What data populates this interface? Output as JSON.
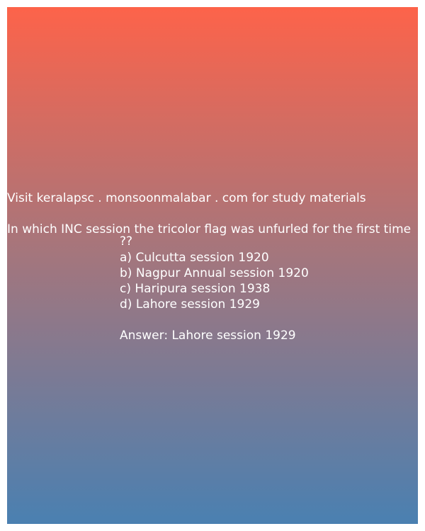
{
  "site_line": "Visit keralapsc . monsoonmalabar . com for study materials",
  "question": {
    "text": "In which INC session the tricolor flag was unfurled for the first time",
    "continuation": "??"
  },
  "options": [
    "a) Culcutta session 1920",
    "b) Nagpur Annual session 1920",
    "c) Haripura session 1938",
    "d) Lahore session 1929"
  ],
  "answer": "Answer: Lahore session 1929",
  "colors": {
    "gradient_top": "#fd634a",
    "gradient_mid": "#a9757a",
    "gradient_bottom": "#4a80b1",
    "text": "#ffffff"
  }
}
